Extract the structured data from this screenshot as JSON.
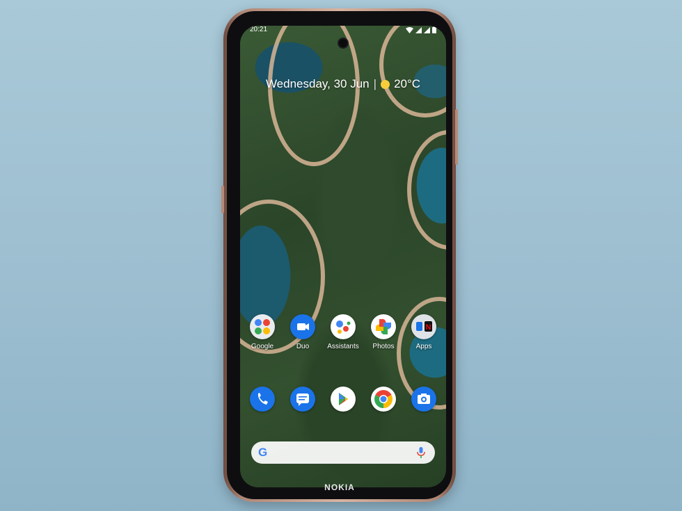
{
  "status_bar": {
    "time": "20:21"
  },
  "glance": {
    "date": "Wednesday, 30 Jun",
    "separator": "|",
    "temperature": "20°C",
    "weather_icon": "sun-icon"
  },
  "apps_row1": [
    {
      "label": "Google",
      "icon": "google-folder-icon"
    },
    {
      "label": "Duo",
      "icon": "duo-icon"
    },
    {
      "label": "Assistants",
      "icon": "assistant-icon"
    },
    {
      "label": "Photos",
      "icon": "photos-icon"
    },
    {
      "label": "Apps",
      "icon": "apps-folder-icon"
    }
  ],
  "dock": [
    {
      "icon": "phone-icon"
    },
    {
      "icon": "messages-icon"
    },
    {
      "icon": "play-store-icon"
    },
    {
      "icon": "chrome-icon"
    },
    {
      "icon": "camera-icon"
    }
  ],
  "search": {
    "logo": "G",
    "mic_icon": "mic-icon"
  },
  "device": {
    "brand": "NOKIA"
  },
  "colors": {
    "background": "#a9c9d8",
    "frame": "#d7b3a1",
    "google_blue": "#4285f4",
    "google_red": "#ea4335",
    "google_yellow": "#fbbc05",
    "google_green": "#34a853"
  }
}
